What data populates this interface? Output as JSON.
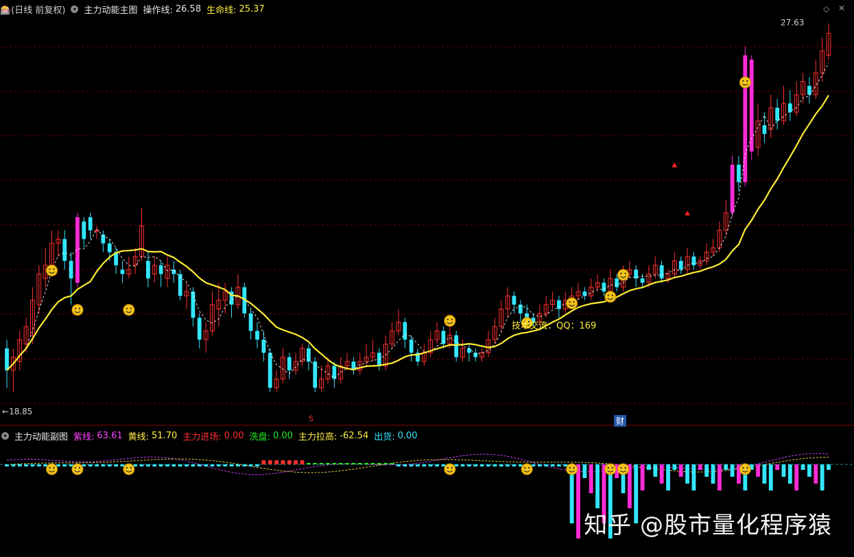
{
  "main_header": {
    "fragment": "🎰(日线 前复权)",
    "indicator_name": "主力动能主图",
    "op_line_label": "操作线:",
    "op_line_value": "26.58",
    "life_line_label": "生命线:",
    "life_line_value": "25.37"
  },
  "sub_header": {
    "indicator_name": "主力动能副图",
    "purple_label": "紫线:",
    "purple_value": "63.61",
    "yellow_label": "黄线:",
    "yellow_value": "51.70",
    "enter_label": "主力进场:",
    "enter_value": "0.00",
    "wash_label": "洗盘:",
    "wash_value": "0.00",
    "pull_label": "主力拉高:",
    "pull_value": "-62.54",
    "ship_label": "出货:",
    "ship_value": "0.00"
  },
  "annotations": {
    "high_price": "27.63",
    "low_price": "18.85",
    "tech_text": "技术交流：QQ：169",
    "marker_s": "S",
    "marker_cai": "财"
  },
  "watermark": "知乎 @股市量化程序猿",
  "colors": {
    "up": "#ff3030",
    "down": "#33e6ff",
    "strong": "#ff2bd6",
    "life_line": "#ffee33",
    "op_line": "#ffffff",
    "grid": "#7a0000",
    "purple_line": "#d040ff",
    "yellow_line": "#e8d040"
  },
  "chart_data": {
    "type": "candlestick",
    "ylim": [
      18.85,
      27.63
    ],
    "grid": true,
    "candles": [
      {
        "o": 20.2,
        "c": 19.7,
        "h": 20.4,
        "l": 19.3
      },
      {
        "o": 19.7,
        "c": 20.0,
        "h": 20.2,
        "l": 19.2
      },
      {
        "o": 19.9,
        "c": 20.4,
        "h": 20.6,
        "l": 19.7
      },
      {
        "o": 20.3,
        "c": 20.7,
        "h": 20.9,
        "l": 20.1
      },
      {
        "o": 20.5,
        "c": 21.3,
        "h": 21.6,
        "l": 20.3
      },
      {
        "o": 21.2,
        "c": 21.9,
        "h": 22.1,
        "l": 21.0
      },
      {
        "o": 21.8,
        "c": 22.1,
        "h": 22.5,
        "l": 21.6
      },
      {
        "o": 22.0,
        "c": 22.6,
        "h": 22.9,
        "l": 21.9
      },
      {
        "o": 22.6,
        "c": 22.7,
        "h": 22.9,
        "l": 22.3
      },
      {
        "o": 22.7,
        "c": 22.2,
        "h": 22.9,
        "l": 22.0
      },
      {
        "o": 22.2,
        "c": 21.8,
        "h": 22.4,
        "l": 21.2
      },
      {
        "o": 21.7,
        "c": 23.2,
        "h": 23.3,
        "l": 21.6
      },
      {
        "o": 23.1,
        "c": 22.7,
        "h": 23.2,
        "l": 22.5
      },
      {
        "o": 23.2,
        "c": 22.9,
        "h": 23.3,
        "l": 22.7
      },
      {
        "o": 22.9,
        "c": 22.9,
        "h": 23.0,
        "l": 22.7
      },
      {
        "o": 22.8,
        "c": 22.6,
        "h": 22.9,
        "l": 22.4
      },
      {
        "o": 22.6,
        "c": 22.4,
        "h": 22.7,
        "l": 22.2
      },
      {
        "o": 22.4,
        "c": 22.1,
        "h": 22.5,
        "l": 21.9
      },
      {
        "o": 22.0,
        "c": 21.9,
        "h": 22.2,
        "l": 21.7
      },
      {
        "o": 21.9,
        "c": 22.0,
        "h": 22.3,
        "l": 21.8
      },
      {
        "o": 22.1,
        "c": 22.3,
        "h": 22.5,
        "l": 21.9
      },
      {
        "o": 22.3,
        "c": 23.0,
        "h": 23.4,
        "l": 22.2
      },
      {
        "o": 22.2,
        "c": 21.8,
        "h": 22.4,
        "l": 21.6
      },
      {
        "o": 21.9,
        "c": 22.1,
        "h": 22.3,
        "l": 21.7
      },
      {
        "o": 22.1,
        "c": 21.9,
        "h": 22.2,
        "l": 21.6
      },
      {
        "o": 21.8,
        "c": 22.1,
        "h": 22.3,
        "l": 21.6
      },
      {
        "o": 22.0,
        "c": 21.9,
        "h": 22.2,
        "l": 21.7
      },
      {
        "o": 21.9,
        "c": 21.4,
        "h": 22.0,
        "l": 21.3
      },
      {
        "o": 21.4,
        "c": 21.5,
        "h": 21.7,
        "l": 21.1
      },
      {
        "o": 21.5,
        "c": 20.9,
        "h": 21.6,
        "l": 20.7
      },
      {
        "o": 20.9,
        "c": 20.4,
        "h": 21.0,
        "l": 20.2
      },
      {
        "o": 20.4,
        "c": 20.6,
        "h": 20.8,
        "l": 20.1
      },
      {
        "o": 20.6,
        "c": 21.2,
        "h": 21.5,
        "l": 20.5
      },
      {
        "o": 21.1,
        "c": 21.3,
        "h": 21.7,
        "l": 20.7
      },
      {
        "o": 21.3,
        "c": 21.5,
        "h": 21.7,
        "l": 21.0
      },
      {
        "o": 21.5,
        "c": 21.2,
        "h": 21.6,
        "l": 20.9
      },
      {
        "o": 21.2,
        "c": 21.6,
        "h": 21.9,
        "l": 21.1
      },
      {
        "o": 21.6,
        "c": 21.0,
        "h": 21.7,
        "l": 20.9
      },
      {
        "o": 21.0,
        "c": 20.6,
        "h": 21.1,
        "l": 20.4
      },
      {
        "o": 20.6,
        "c": 20.4,
        "h": 20.8,
        "l": 20.2
      },
      {
        "o": 20.4,
        "c": 20.1,
        "h": 20.6,
        "l": 19.9
      },
      {
        "o": 20.1,
        "c": 19.3,
        "h": 20.2,
        "l": 19.2
      },
      {
        "o": 19.3,
        "c": 19.5,
        "h": 19.7,
        "l": 19.2
      },
      {
        "o": 19.5,
        "c": 20.0,
        "h": 20.2,
        "l": 19.4
      },
      {
        "o": 20.0,
        "c": 19.7,
        "h": 20.1,
        "l": 19.5
      },
      {
        "o": 19.7,
        "c": 19.9,
        "h": 20.1,
        "l": 19.6
      },
      {
        "o": 19.9,
        "c": 20.2,
        "h": 20.3,
        "l": 19.8
      },
      {
        "o": 20.2,
        "c": 19.9,
        "h": 20.3,
        "l": 19.7
      },
      {
        "o": 19.9,
        "c": 19.3,
        "h": 20.0,
        "l": 19.2
      },
      {
        "o": 19.3,
        "c": 19.5,
        "h": 19.8,
        "l": 19.2
      },
      {
        "o": 19.5,
        "c": 19.8,
        "h": 20.0,
        "l": 19.4
      },
      {
        "o": 19.8,
        "c": 19.5,
        "h": 19.9,
        "l": 19.3
      },
      {
        "o": 19.5,
        "c": 19.8,
        "h": 20.0,
        "l": 19.4
      },
      {
        "o": 19.8,
        "c": 19.9,
        "h": 20.1,
        "l": 19.7
      },
      {
        "o": 19.9,
        "c": 19.7,
        "h": 20.0,
        "l": 19.6
      },
      {
        "o": 19.7,
        "c": 19.9,
        "h": 20.1,
        "l": 19.6
      },
      {
        "o": 19.9,
        "c": 20.0,
        "h": 20.3,
        "l": 19.8
      },
      {
        "o": 20.0,
        "c": 20.1,
        "h": 20.4,
        "l": 19.9
      },
      {
        "o": 20.1,
        "c": 19.8,
        "h": 20.2,
        "l": 19.7
      },
      {
        "o": 19.8,
        "c": 20.3,
        "h": 20.5,
        "l": 19.7
      },
      {
        "o": 20.3,
        "c": 20.6,
        "h": 20.8,
        "l": 20.2
      },
      {
        "o": 20.6,
        "c": 20.8,
        "h": 21.1,
        "l": 20.5
      },
      {
        "o": 20.8,
        "c": 20.4,
        "h": 20.9,
        "l": 20.2
      },
      {
        "o": 20.4,
        "c": 20.1,
        "h": 20.5,
        "l": 19.9
      },
      {
        "o": 20.1,
        "c": 19.9,
        "h": 20.2,
        "l": 19.8
      },
      {
        "o": 19.9,
        "c": 20.1,
        "h": 20.3,
        "l": 19.8
      },
      {
        "o": 20.1,
        "c": 20.4,
        "h": 20.6,
        "l": 20.0
      },
      {
        "o": 20.4,
        "c": 20.6,
        "h": 20.8,
        "l": 20.3
      },
      {
        "o": 20.6,
        "c": 20.3,
        "h": 20.7,
        "l": 20.2
      },
      {
        "o": 20.3,
        "c": 20.5,
        "h": 20.7,
        "l": 20.2
      },
      {
        "o": 20.5,
        "c": 20.0,
        "h": 20.6,
        "l": 19.9
      },
      {
        "o": 20.0,
        "c": 20.2,
        "h": 20.4,
        "l": 19.9
      },
      {
        "o": 20.2,
        "c": 20.1,
        "h": 20.3,
        "l": 19.9
      },
      {
        "o": 20.1,
        "c": 20.0,
        "h": 20.2,
        "l": 19.9
      },
      {
        "o": 20.0,
        "c": 20.1,
        "h": 20.2,
        "l": 19.9
      },
      {
        "o": 20.1,
        "c": 20.4,
        "h": 20.6,
        "l": 20.0
      },
      {
        "o": 20.4,
        "c": 20.7,
        "h": 20.9,
        "l": 20.3
      },
      {
        "o": 20.7,
        "c": 21.1,
        "h": 21.3,
        "l": 20.6
      },
      {
        "o": 21.1,
        "c": 21.4,
        "h": 21.6,
        "l": 20.9
      },
      {
        "o": 21.4,
        "c": 21.2,
        "h": 21.5,
        "l": 21.0
      },
      {
        "o": 21.2,
        "c": 21.0,
        "h": 21.3,
        "l": 20.8
      },
      {
        "o": 21.0,
        "c": 20.9,
        "h": 21.2,
        "l": 20.7
      },
      {
        "o": 20.9,
        "c": 20.8,
        "h": 21.0,
        "l": 20.7
      },
      {
        "o": 20.8,
        "c": 21.0,
        "h": 21.2,
        "l": 20.7
      },
      {
        "o": 21.0,
        "c": 21.2,
        "h": 21.4,
        "l": 20.9
      },
      {
        "o": 21.2,
        "c": 21.3,
        "h": 21.5,
        "l": 21.1
      },
      {
        "o": 21.3,
        "c": 21.1,
        "h": 21.4,
        "l": 20.9
      },
      {
        "o": 21.1,
        "c": 21.3,
        "h": 21.5,
        "l": 21.0
      },
      {
        "o": 21.3,
        "c": 21.4,
        "h": 21.6,
        "l": 21.2
      },
      {
        "o": 21.4,
        "c": 21.5,
        "h": 21.7,
        "l": 21.3
      },
      {
        "o": 21.5,
        "c": 21.4,
        "h": 21.6,
        "l": 21.3
      },
      {
        "o": 21.4,
        "c": 21.6,
        "h": 21.8,
        "l": 21.3
      },
      {
        "o": 21.6,
        "c": 21.7,
        "h": 21.9,
        "l": 21.5
      },
      {
        "o": 21.7,
        "c": 21.5,
        "h": 21.8,
        "l": 21.4
      },
      {
        "o": 21.5,
        "c": 21.8,
        "h": 22.0,
        "l": 21.4
      },
      {
        "o": 21.8,
        "c": 21.6,
        "h": 21.9,
        "l": 21.5
      },
      {
        "o": 21.6,
        "c": 21.9,
        "h": 22.1,
        "l": 21.5
      },
      {
        "o": 21.9,
        "c": 22.0,
        "h": 22.2,
        "l": 21.8
      },
      {
        "o": 22.0,
        "c": 21.8,
        "h": 22.1,
        "l": 21.6
      },
      {
        "o": 21.8,
        "c": 21.7,
        "h": 21.9,
        "l": 21.6
      },
      {
        "o": 21.7,
        "c": 21.9,
        "h": 22.1,
        "l": 21.6
      },
      {
        "o": 21.9,
        "c": 22.1,
        "h": 22.3,
        "l": 21.8
      },
      {
        "o": 22.1,
        "c": 21.8,
        "h": 22.2,
        "l": 21.7
      },
      {
        "o": 21.8,
        "c": 21.9,
        "h": 22.0,
        "l": 21.7
      },
      {
        "o": 21.9,
        "c": 22.2,
        "h": 22.4,
        "l": 21.8
      },
      {
        "o": 22.2,
        "c": 22.0,
        "h": 22.3,
        "l": 21.9
      },
      {
        "o": 22.0,
        "c": 22.3,
        "h": 22.5,
        "l": 21.9
      },
      {
        "o": 22.3,
        "c": 22.1,
        "h": 22.4,
        "l": 22.0
      },
      {
        "o": 22.1,
        "c": 22.2,
        "h": 22.3,
        "l": 22.0
      },
      {
        "o": 22.2,
        "c": 22.4,
        "h": 22.6,
        "l": 22.1
      },
      {
        "o": 22.4,
        "c": 22.5,
        "h": 22.7,
        "l": 22.3
      },
      {
        "o": 22.5,
        "c": 22.9,
        "h": 23.1,
        "l": 22.4
      },
      {
        "o": 22.9,
        "c": 23.3,
        "h": 23.6,
        "l": 22.8
      },
      {
        "o": 23.3,
        "c": 24.4,
        "h": 24.6,
        "l": 23.2
      },
      {
        "o": 24.4,
        "c": 24.0,
        "h": 24.6,
        "l": 23.8
      },
      {
        "o": 24.0,
        "c": 26.9,
        "h": 27.1,
        "l": 23.9
      },
      {
        "o": 26.8,
        "c": 24.7,
        "h": 26.9,
        "l": 24.5
      },
      {
        "o": 24.8,
        "c": 25.4,
        "h": 25.8,
        "l": 24.6
      },
      {
        "o": 25.3,
        "c": 25.1,
        "h": 25.6,
        "l": 24.9
      },
      {
        "o": 25.2,
        "c": 25.7,
        "h": 26.0,
        "l": 25.0
      },
      {
        "o": 25.7,
        "c": 25.4,
        "h": 25.9,
        "l": 25.2
      },
      {
        "o": 25.4,
        "c": 25.8,
        "h": 26.2,
        "l": 25.3
      },
      {
        "o": 25.8,
        "c": 25.6,
        "h": 26.1,
        "l": 25.4
      },
      {
        "o": 25.6,
        "c": 26.0,
        "h": 26.3,
        "l": 25.5
      },
      {
        "o": 26.0,
        "c": 26.3,
        "h": 26.5,
        "l": 25.8
      },
      {
        "o": 26.2,
        "c": 26.0,
        "h": 26.4,
        "l": 25.8
      },
      {
        "o": 26.0,
        "c": 26.5,
        "h": 26.8,
        "l": 25.9
      },
      {
        "o": 26.5,
        "c": 27.0,
        "h": 27.3,
        "l": 26.3
      },
      {
        "o": 26.9,
        "c": 27.4,
        "h": 27.63,
        "l": 26.8
      }
    ]
  }
}
